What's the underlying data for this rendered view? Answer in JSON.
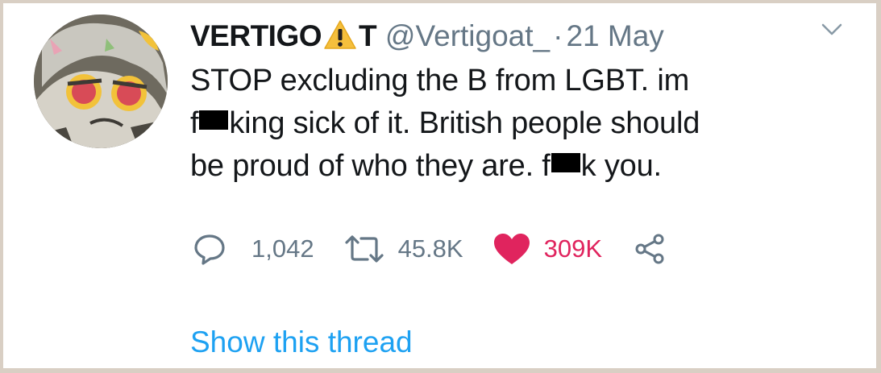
{
  "tweet": {
    "display_name": "VERTIGO",
    "display_name_suffix": "T",
    "name_icon": "warning-sign-icon",
    "handle": "@Vertigoat_",
    "separator": "·",
    "date": "21 May",
    "text": {
      "line1": "STOP excluding the B from LGBT. im",
      "line2_start": "f",
      "line2_end": "king sick of it. British people should",
      "line3_start": "be proud of who they are. f",
      "line3_end": "k you."
    },
    "stats": {
      "replies": "1,042",
      "retweets": "45.8K",
      "likes": "309K"
    },
    "icons": {
      "reply": "reply-bubble-icon",
      "retweet": "retweet-icon",
      "like": "heart-icon",
      "share": "share-icon",
      "menu": "chevron-down-icon"
    },
    "show_thread": "Show this thread"
  },
  "colors": {
    "text": "#14171a",
    "secondary": "#657786",
    "link": "#1da1f2",
    "like": "#e0245e",
    "warning": "#ffcc4d"
  }
}
